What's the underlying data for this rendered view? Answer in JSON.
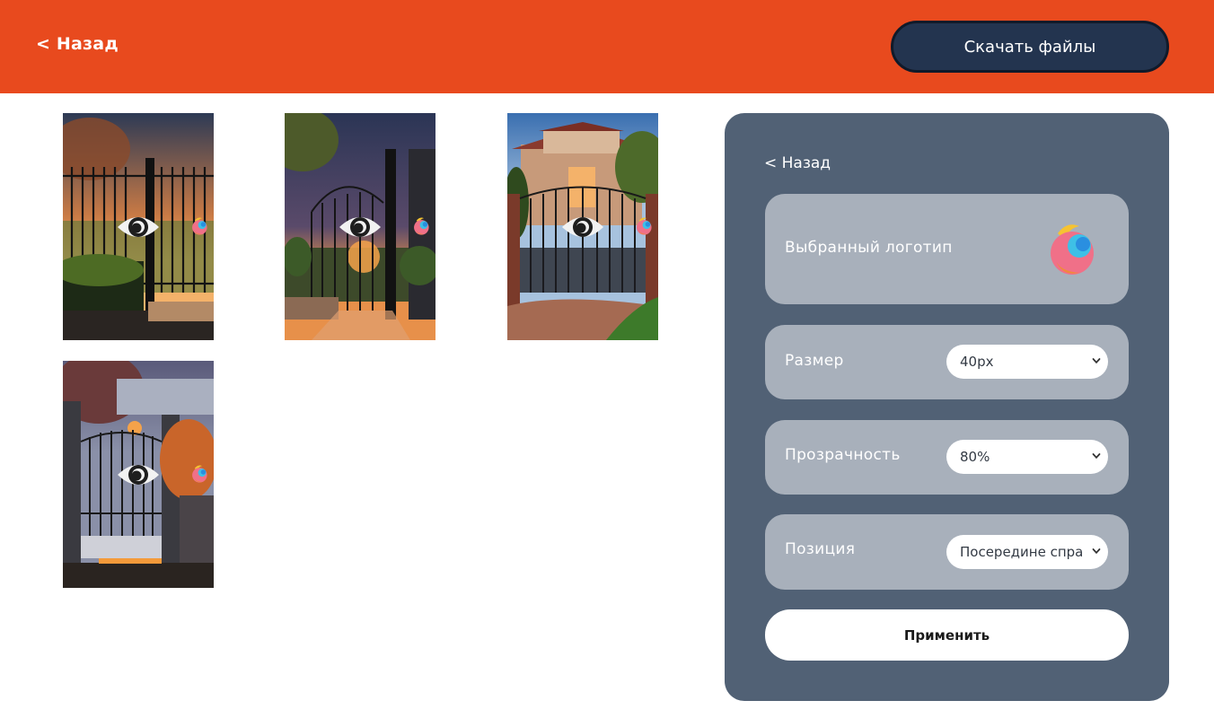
{
  "header": {
    "back_label": "< Назад",
    "download_label": "Скачать файлы",
    "bg_color": "#e84a1e",
    "button_color": "#23344f"
  },
  "gallery": {
    "items": [
      {
        "scene": "wrought-iron gate at sunset",
        "overlay_icon": "eye-icon",
        "watermark": "logo-icon"
      },
      {
        "scene": "ornate gate with lanterns at dusk",
        "overlay_icon": "eye-icon",
        "watermark": "logo-icon"
      },
      {
        "scene": "villa with iron gate",
        "overlay_icon": "eye-icon",
        "watermark": "logo-icon"
      },
      {
        "scene": "stone-pillar gate at night",
        "overlay_icon": "eye-icon",
        "watermark": "logo-icon"
      }
    ]
  },
  "settings": {
    "back_label": "< Назад",
    "logo_label": "Выбранный логотип",
    "size_label": "Размер",
    "size_value": "40px",
    "opacity_label": "Прозрачность",
    "opacity_value": "80%",
    "position_label": "Позиция",
    "position_value": "Посередине справа",
    "apply_label": "Применить",
    "panel_color": "#516175",
    "card_color": "#a8b0bb"
  }
}
